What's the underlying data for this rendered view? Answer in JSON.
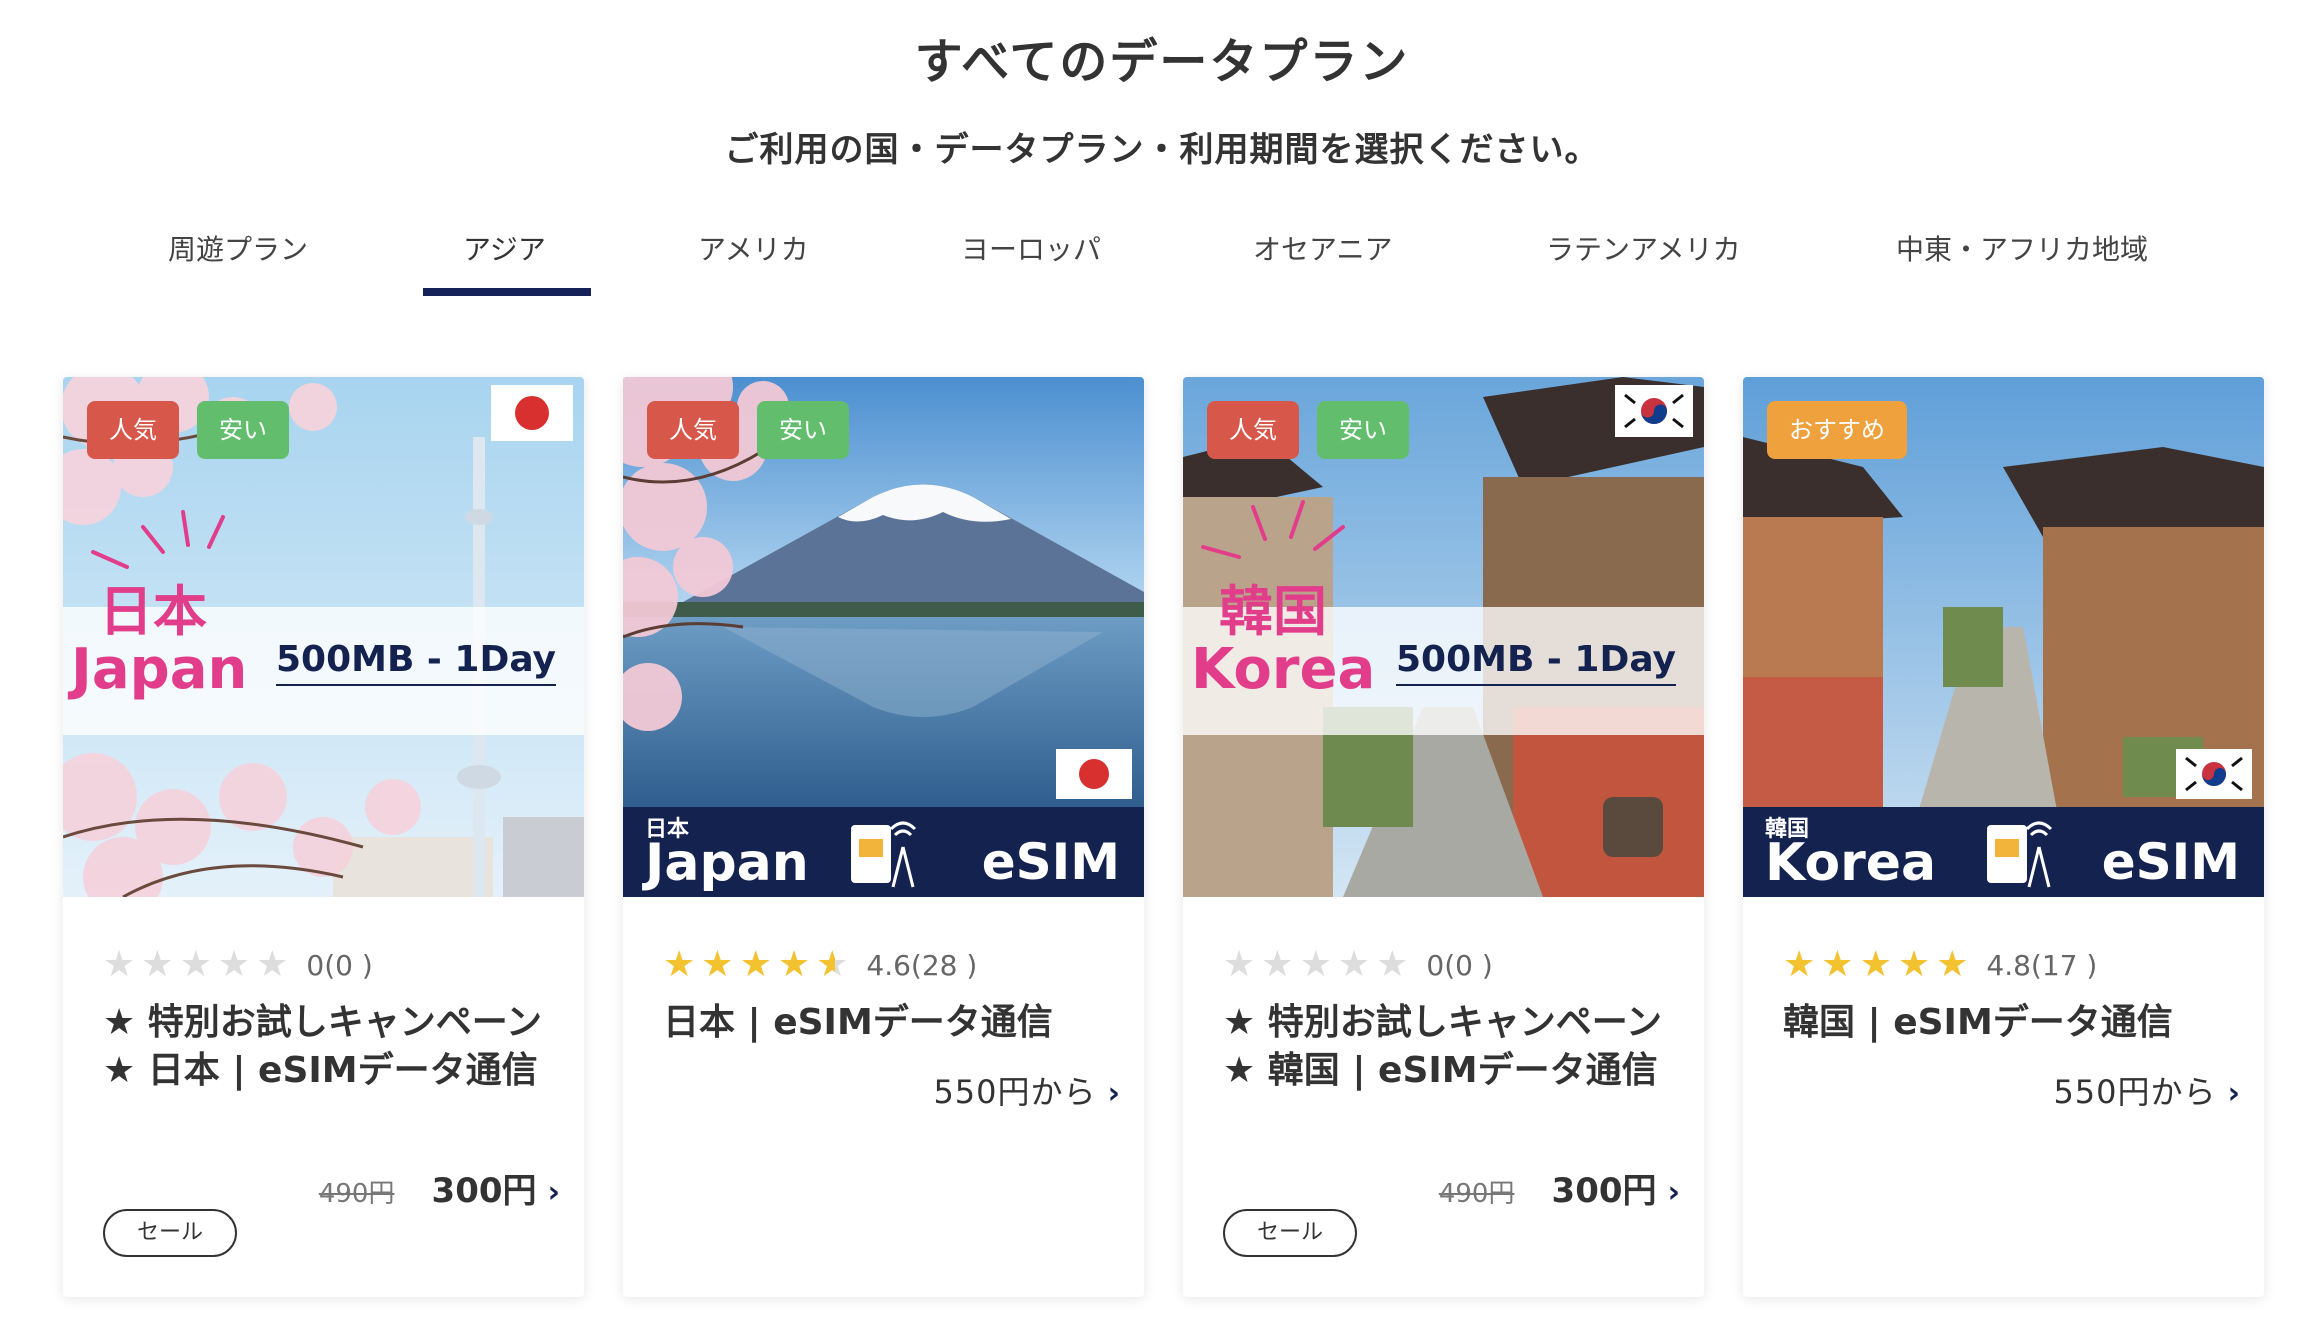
{
  "header": {
    "title": "すべてのデータプラン",
    "subtitle": "ご利用の国・データプラン・利用期間を選択ください。"
  },
  "tabs": [
    {
      "label": "周遊プラン"
    },
    {
      "label": "アジア",
      "active": true
    },
    {
      "label": "アメリカ"
    },
    {
      "label": "ヨーロッパ"
    },
    {
      "label": "オセアニア"
    },
    {
      "label": "ラテンアメリカ"
    },
    {
      "label": "中東・アフリカ地域"
    }
  ],
  "colors": {
    "accent": "#14224f",
    "badge_red": "#d8574b",
    "badge_green": "#62be6c",
    "badge_orange": "#eea13c",
    "star": "#f2c231"
  },
  "cards": [
    {
      "badges": [
        "人気",
        "安い"
      ],
      "flag": "japan-flag",
      "image_jp": "日本",
      "image_en": "Japan",
      "image_data": "500MB - 1Day",
      "stars": 0,
      "rating_text": "0(0 )",
      "title": "★ 特別お試しキャンペーン ★ 日本 | eSIMデータ通信",
      "old_price": "490円",
      "price": "300円",
      "sale_label": "セール"
    },
    {
      "badges": [
        "人気",
        "安い"
      ],
      "flag": "japan-flag",
      "image_jp": "日本",
      "image_en": "Japan",
      "image_esim": "eSIM",
      "stars": 4.6,
      "rating_text": "4.6(28 )",
      "title": "日本 | eSIMデータ通信",
      "price_from": "550円から"
    },
    {
      "badges": [
        "人気",
        "安い"
      ],
      "flag": "korea-flag",
      "image_jp": "韓国",
      "image_en": "Korea",
      "image_data": "500MB - 1Day",
      "stars": 0,
      "rating_text": "0(0 )",
      "title": "★ 特別お試しキャンペーン ★ 韓国 | eSIMデータ通信",
      "old_price": "490円",
      "price": "300円",
      "sale_label": "セール"
    },
    {
      "badges": [
        "おすすめ"
      ],
      "flag": "korea-flag",
      "image_jp": "韓国",
      "image_en": "Korea",
      "image_esim": "eSIM",
      "stars": 4.8,
      "rating_text": "4.8(17 )",
      "title": "韓国 | eSIMデータ通信",
      "price_from": "550円から"
    }
  ]
}
